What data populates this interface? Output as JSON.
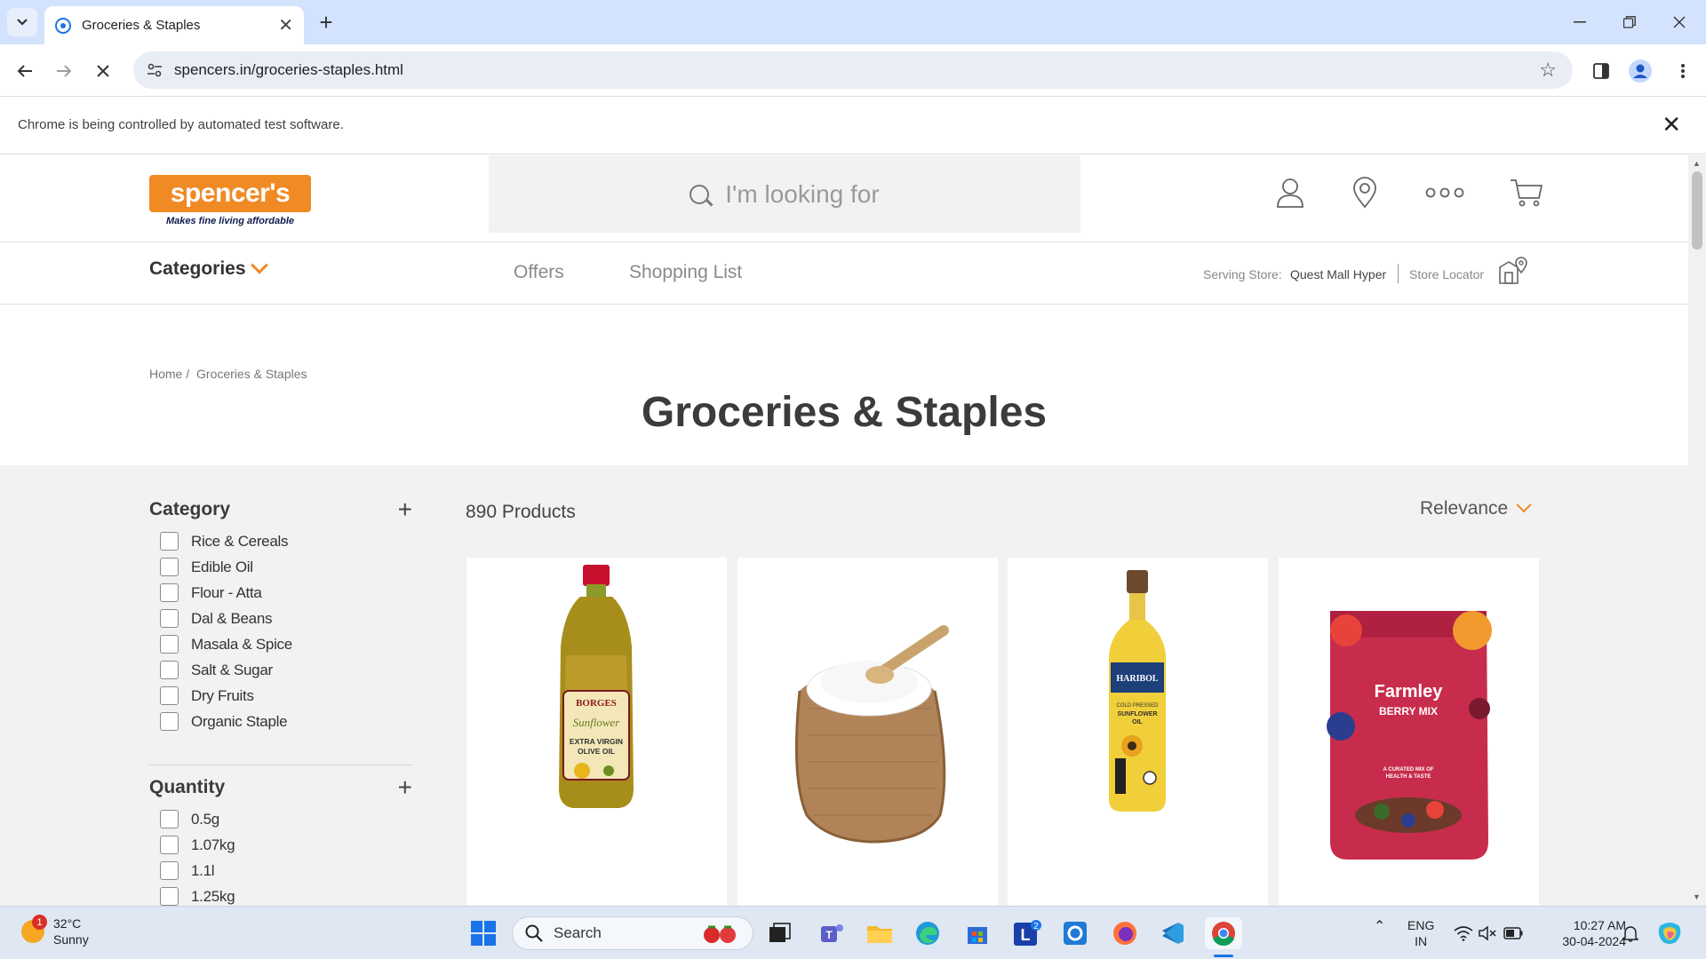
{
  "browser": {
    "tab_title": "Groceries & Staples",
    "url": "spencers.in/groceries-staples.html",
    "infobar_message": "Chrome is being controlled by automated test software."
  },
  "site": {
    "logo_text": "spencer's",
    "logo_tagline": "Makes fine living affordable",
    "search_placeholder": "I'm looking for",
    "nav": {
      "categories": "Categories",
      "offers": "Offers",
      "shopping_list": "Shopping List",
      "serving_store_label": "Serving Store:",
      "serving_store_value": "Quest Mall Hyper",
      "store_locator": "Store Locator"
    },
    "breadcrumb": {
      "home": "Home /",
      "current": "Groceries & Staples"
    },
    "page_title": "Groceries & Staples",
    "brand_color": "#f08a24"
  },
  "filters": {
    "category": {
      "title": "Category",
      "options": [
        "Rice & Cereals",
        "Edible Oil",
        "Flour - Atta",
        "Dal & Beans",
        "Masala & Spice",
        "Salt & Sugar",
        "Dry Fruits",
        "Organic Staple"
      ]
    },
    "quantity": {
      "title": "Quantity",
      "options": [
        "0.5g",
        "1.07kg",
        "1.1l",
        "1.25kg"
      ]
    }
  },
  "listing": {
    "product_count": "890 Products",
    "sort_label": "Relevance",
    "products": [
      {
        "name": "olive-oil-bottle",
        "label_lines": [
          "BORGES",
          "Sunflower",
          "EXTRA VIRGIN",
          "OLIVE OIL"
        ]
      },
      {
        "name": "sugar-sack",
        "label_lines": []
      },
      {
        "name": "sunflower-oil-bottle",
        "label_lines": [
          "HARIBOL",
          "COLD PRESSED",
          "SUNFLOWER",
          "OIL"
        ]
      },
      {
        "name": "berry-mix-pouch",
        "label_lines": [
          "Farmley",
          "BERRY MIX",
          "A CURATED MIX OF",
          "HEALTH & TASTE"
        ]
      }
    ]
  },
  "taskbar": {
    "weather_badge": "1",
    "temperature": "32°C",
    "condition": "Sunny",
    "search_label": "Search",
    "lang_top": "ENG",
    "lang_bottom": "IN",
    "time": "10:27 AM",
    "date": "30-04-2024",
    "mail_badge": "2"
  }
}
